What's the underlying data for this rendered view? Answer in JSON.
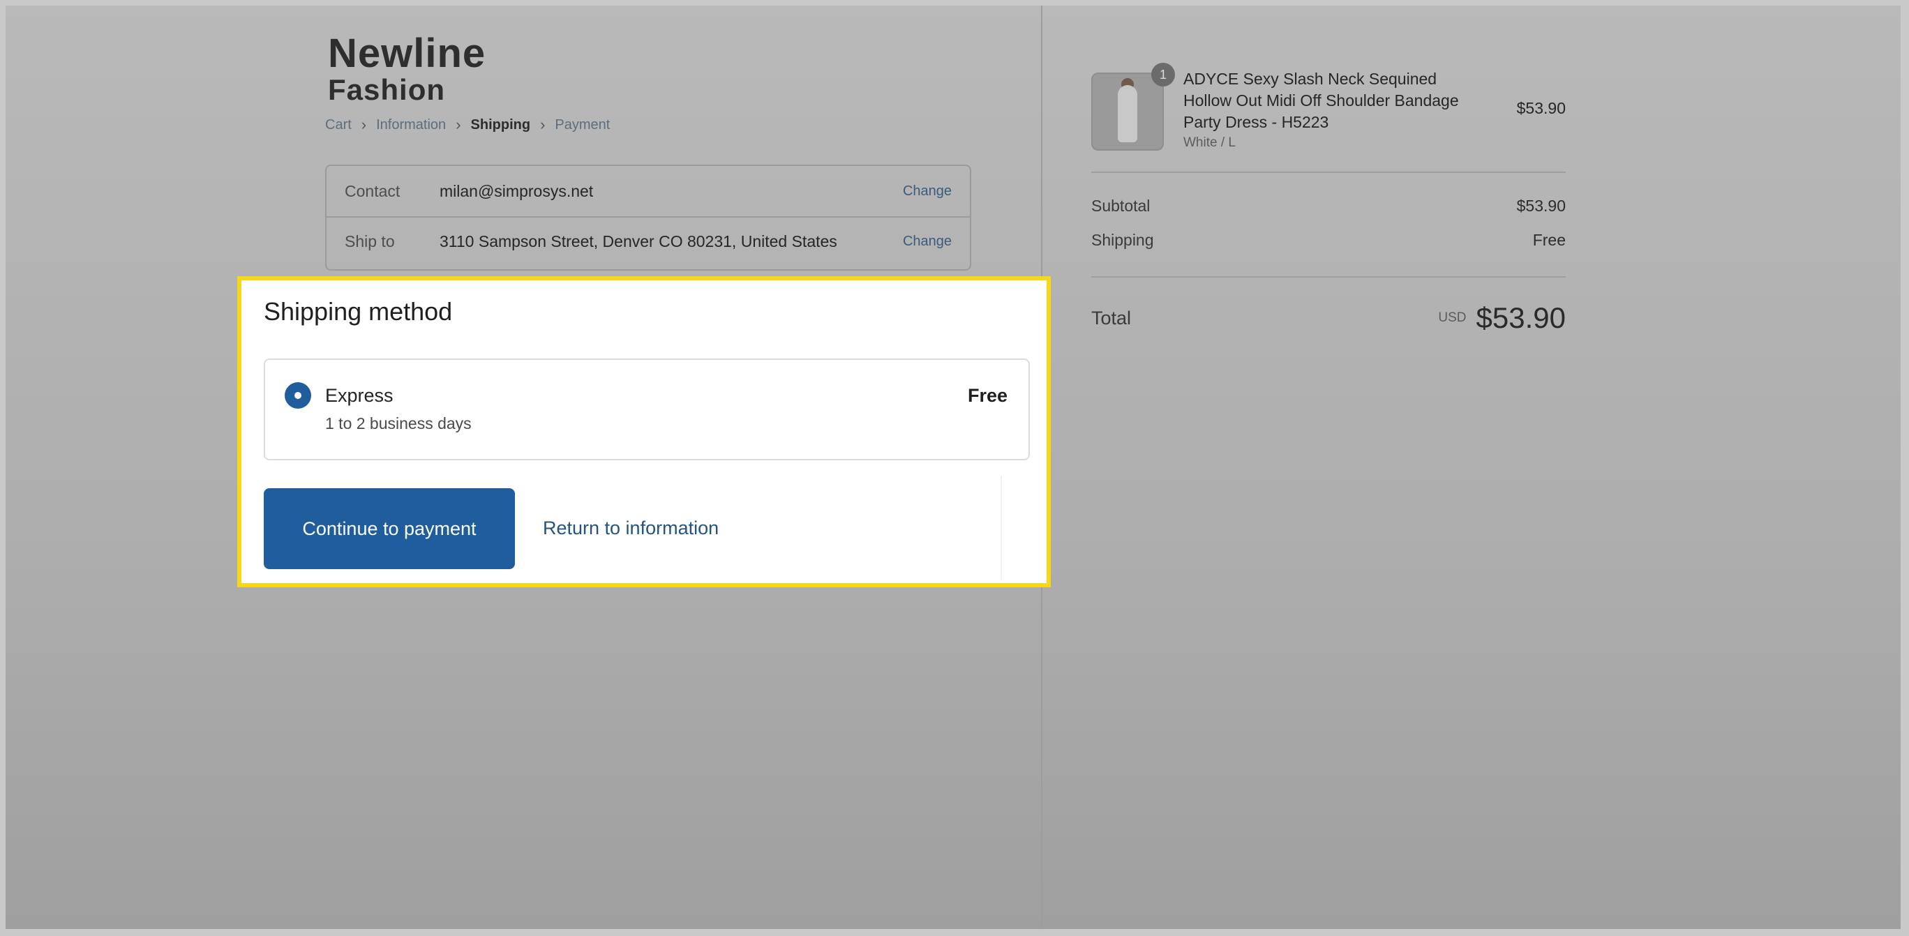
{
  "store": {
    "name_line1": "Newline",
    "name_line2": "Fashion"
  },
  "breadcrumb": [
    {
      "label": "Cart"
    },
    {
      "label": "Information"
    },
    {
      "label": "Shipping",
      "current": true
    },
    {
      "label": "Payment"
    }
  ],
  "review": {
    "contact_label": "Contact",
    "contact_value": "milan@simprosys.net",
    "ship_label": "Ship to",
    "ship_value": "3110 Sampson Street, Denver CO 80231, United States",
    "change_label": "Change"
  },
  "modal": {
    "title": "Shipping method",
    "option": {
      "name": "Express",
      "days": "1 to 2 business days",
      "price": "Free",
      "selected": true
    },
    "continue_label": "Continue to payment",
    "return_label": "Return to information",
    "highlight_color": "#f4d819",
    "accent": "#1f5d9d"
  },
  "order": {
    "quantity": "1",
    "product_name": "ADYCE Sexy Slash Neck Sequined Hollow Out Midi Off Shoulder Bandage Party Dress - H5223",
    "variant": "White / L",
    "price": "$53.90"
  },
  "summary": {
    "subtotal_label": "Subtotal",
    "subtotal_value": "$53.90",
    "shipping_label": "Shipping",
    "shipping_value": "Free",
    "total_label": "Total",
    "currency": "USD",
    "total_value": "$53.90"
  }
}
